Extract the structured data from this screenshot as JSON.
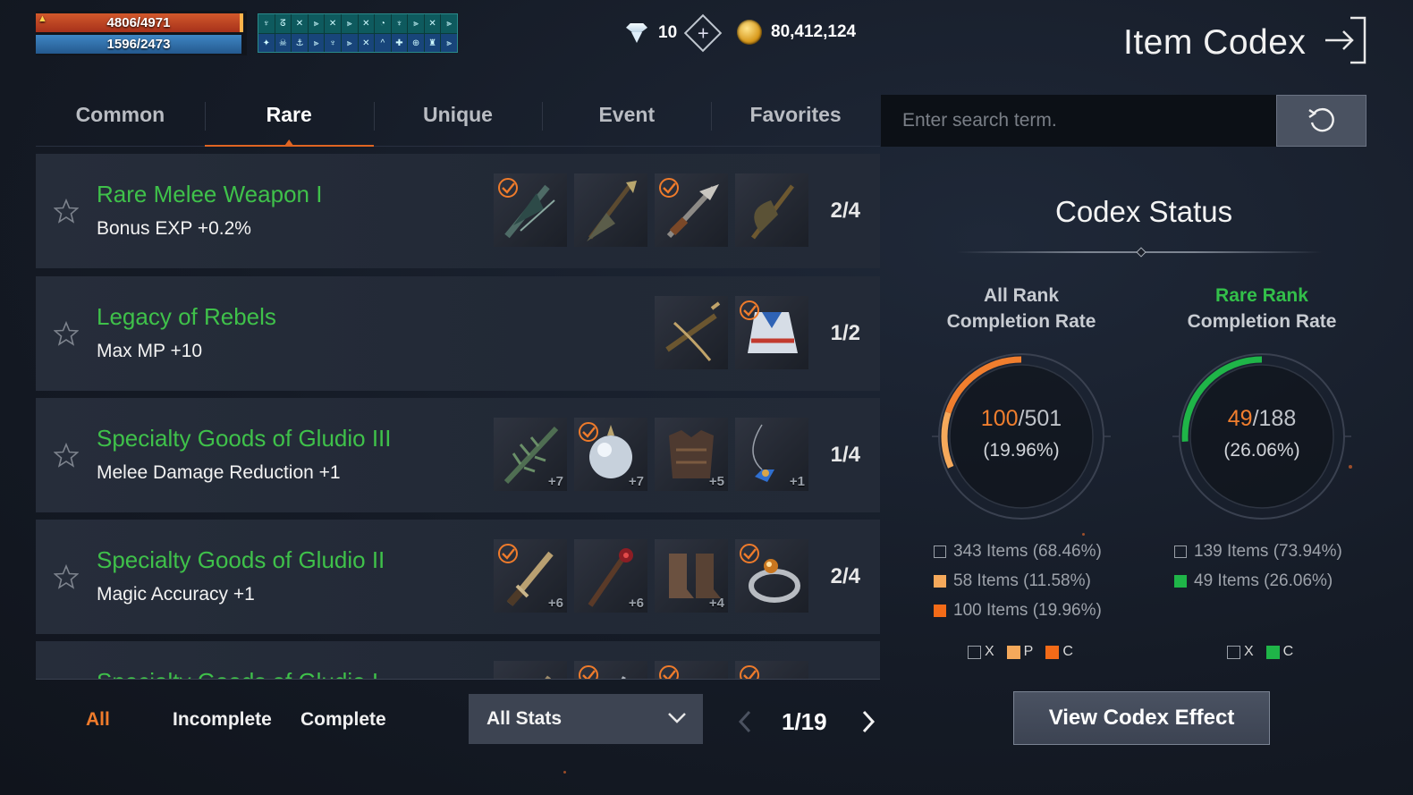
{
  "hud": {
    "hp": "4806/4971",
    "mp": "1596/2473",
    "buffs_row1": [
      "♆",
      "ᘔ",
      "✕",
      "⫸",
      "✕",
      "⫸",
      "✕",
      "◔",
      "♆",
      "⫸",
      "✕",
      "⫸"
    ],
    "buffs_row2": [
      "✦",
      "☠",
      "⚓",
      "⫸",
      "♆",
      "⫸",
      "✕",
      "^",
      "✚",
      "⊕",
      "♜",
      "⫸"
    ]
  },
  "currency": {
    "diamonds": "10",
    "gold": "80,412,124"
  },
  "page_title": "Item Codex",
  "tabs": [
    {
      "label": "Common",
      "active": false
    },
    {
      "label": "Rare",
      "active": true
    },
    {
      "label": "Unique",
      "active": false
    },
    {
      "label": "Event",
      "active": false
    },
    {
      "label": "Favorites",
      "active": false
    }
  ],
  "search": {
    "placeholder": "Enter search term."
  },
  "codex_entries": [
    {
      "title": "Rare Melee Weapon I",
      "bonus": "Bonus EXP +0.2%",
      "count": "2/4",
      "items": [
        {
          "icon": "wing-sword-icon",
          "checked": true,
          "level": ""
        },
        {
          "icon": "spear-icon",
          "checked": false,
          "level": ""
        },
        {
          "icon": "claw-blade-icon",
          "checked": true,
          "level": ""
        },
        {
          "icon": "axe-icon",
          "checked": false,
          "level": ""
        }
      ]
    },
    {
      "title": "Legacy of Rebels",
      "bonus": "Max MP +10",
      "count": "1/2",
      "items": [
        {
          "icon": "crossbow-icon",
          "checked": false,
          "level": ""
        },
        {
          "icon": "robe-icon",
          "checked": true,
          "level": ""
        }
      ]
    },
    {
      "title": "Specialty Goods of Gludio III",
      "bonus": "Melee Damage Reduction +1",
      "count": "1/4",
      "items": [
        {
          "icon": "thorn-sword-icon",
          "checked": false,
          "level": "+7"
        },
        {
          "icon": "orb-icon",
          "checked": true,
          "level": "+7"
        },
        {
          "icon": "armor-icon",
          "checked": false,
          "level": "+5"
        },
        {
          "icon": "necklace-icon",
          "checked": false,
          "level": "+1"
        }
      ]
    },
    {
      "title": "Specialty Goods of Gludio II",
      "bonus": "Magic Accuracy +1",
      "count": "2/4",
      "items": [
        {
          "icon": "dagger-icon",
          "checked": true,
          "level": "+6"
        },
        {
          "icon": "staff-icon",
          "checked": false,
          "level": "+6"
        },
        {
          "icon": "boots-icon",
          "checked": false,
          "level": "+4"
        },
        {
          "icon": "ring-icon",
          "checked": true,
          "level": ""
        }
      ]
    },
    {
      "title": "Specialty Goods of Gludio I",
      "bonus": "",
      "count": "",
      "items": [
        {
          "icon": "sword-icon",
          "checked": false,
          "level": ""
        },
        {
          "icon": "blade-icon",
          "checked": true,
          "level": ""
        },
        {
          "icon": "gloves-icon",
          "checked": true,
          "level": ""
        },
        {
          "icon": "helmet-icon",
          "checked": true,
          "level": ""
        }
      ]
    }
  ],
  "filters": [
    {
      "label": "All",
      "active": true
    },
    {
      "label": "Incomplete",
      "active": false
    },
    {
      "label": "Complete",
      "active": false
    }
  ],
  "stat_filter": {
    "selected": "All Stats"
  },
  "pagination": {
    "current": 1,
    "total": 19,
    "text": "1/19"
  },
  "codex_status": {
    "title": "Codex Status",
    "all_rank": {
      "line1": "All Rank",
      "line2": "Completion Rate",
      "completed": "100",
      "total": "/501",
      "percent": "(19.96%)",
      "fraction": 0.1996,
      "color": "#f07e2e",
      "stats": [
        {
          "type": "x",
          "text": "343 Items (68.46%)"
        },
        {
          "type": "p",
          "text": "58 Items (11.58%)"
        },
        {
          "type": "c",
          "text": "100 Items (19.96%)"
        }
      ],
      "legend": [
        {
          "type": "x",
          "label": "X"
        },
        {
          "type": "p",
          "label": "P"
        },
        {
          "type": "c",
          "label": "C"
        }
      ]
    },
    "rare_rank": {
      "line1": "Rare Rank",
      "line2": "Completion Rate",
      "completed": "49",
      "total": "/188",
      "percent": "(26.06%)",
      "fraction": 0.2606,
      "color": "#1fb548",
      "stats": [
        {
          "type": "x",
          "text": "139 Items (73.94%)"
        },
        {
          "type": "g",
          "text": "49 Items (26.06%)"
        }
      ],
      "legend": [
        {
          "type": "x",
          "label": "X"
        },
        {
          "type": "g",
          "label": "C"
        }
      ]
    },
    "view_button": "View Codex Effect"
  },
  "colors": {
    "accent": "#e06522",
    "entry_title": "#3fc14a",
    "rare_rank_head": "#33c04a",
    "all_rank_head": "#c8ccd2"
  }
}
